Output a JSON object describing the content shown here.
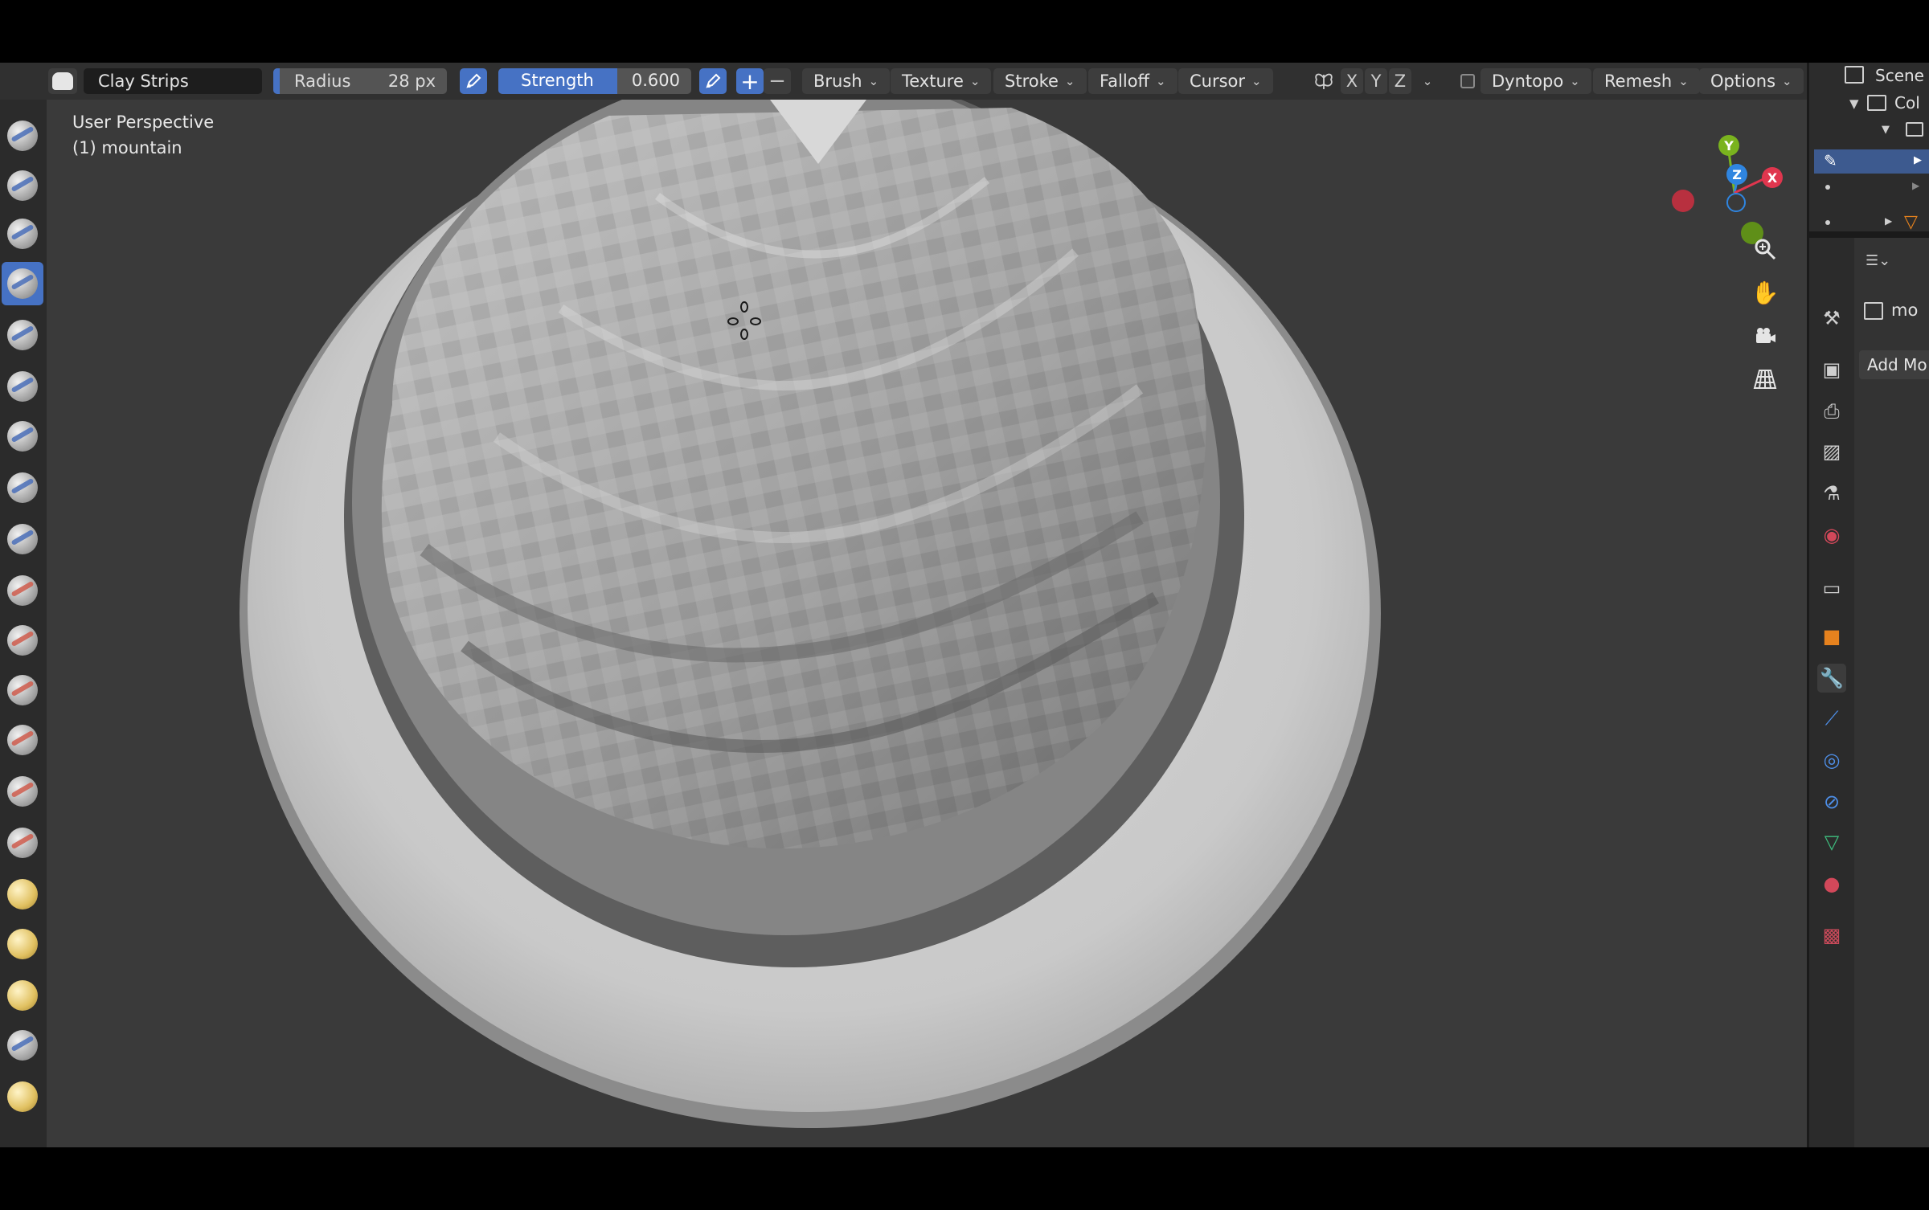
{
  "header": {
    "brush_name": "Clay Strips",
    "radius_label": "Radius",
    "radius_value": "28 px",
    "strength_label": "Strength",
    "strength_value": "0.600",
    "menus": {
      "brush": "Brush",
      "texture": "Texture",
      "stroke": "Stroke",
      "falloff": "Falloff",
      "cursor": "Cursor"
    },
    "axes": [
      "X",
      "Y",
      "Z"
    ],
    "dyntopo": "Dyntopo",
    "remesh": "Remesh",
    "options": "Options"
  },
  "viewport": {
    "view_name": "User Perspective",
    "object_name": "(1) mountain",
    "gizmo": {
      "x": "X",
      "y": "Y",
      "z": "Z"
    }
  },
  "outliner": {
    "scene": "Scene C",
    "collection": "Col"
  },
  "properties": {
    "object_field": "mo",
    "add_modifier": "Add Mo"
  },
  "colors": {
    "accent": "#4672c4",
    "axis_x": "#e0364e",
    "axis_y": "#7ab31e",
    "axis_z": "#2f85e0"
  }
}
